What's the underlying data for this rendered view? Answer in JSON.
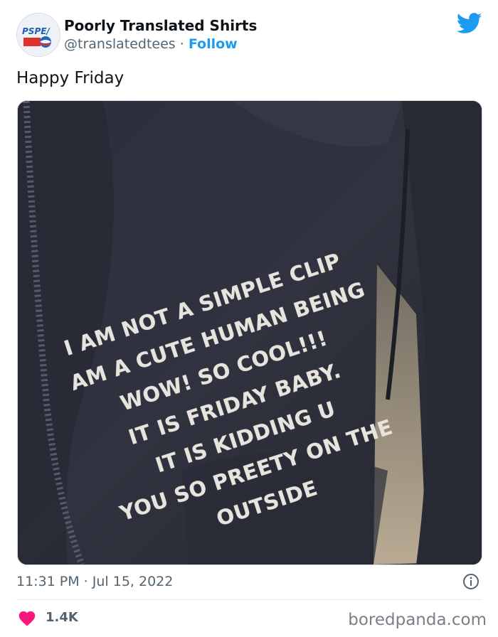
{
  "tweet": {
    "author": {
      "avatar_text": "PSPE/",
      "display_name": "Poorly Translated Shirts",
      "handle": "@translatedtees",
      "separator": "·",
      "follow_label": "Follow"
    },
    "text": "Happy Friday",
    "image": {
      "shirt_lines": [
        "I AM NOT A SIMPLE CLIP",
        "AM A CUTE  HUMAN BEING",
        "WOW! SO COOL!!!",
        "IT IS FRIDAY BABY.",
        "IT IS KIDDING U",
        "YOU SO PREETY ON THE",
        "OUTSIDE"
      ]
    },
    "timestamp": "11:31 PM · Jul 15, 2022",
    "likes": "1.4K"
  },
  "watermark": "boredpanda.com",
  "colors": {
    "accent": "#1d9bf0",
    "heart": "#f91880",
    "muted_text": "#536471"
  },
  "icons": {
    "bird": "twitter-bird-icon",
    "info": "info-icon",
    "heart": "heart-icon"
  }
}
